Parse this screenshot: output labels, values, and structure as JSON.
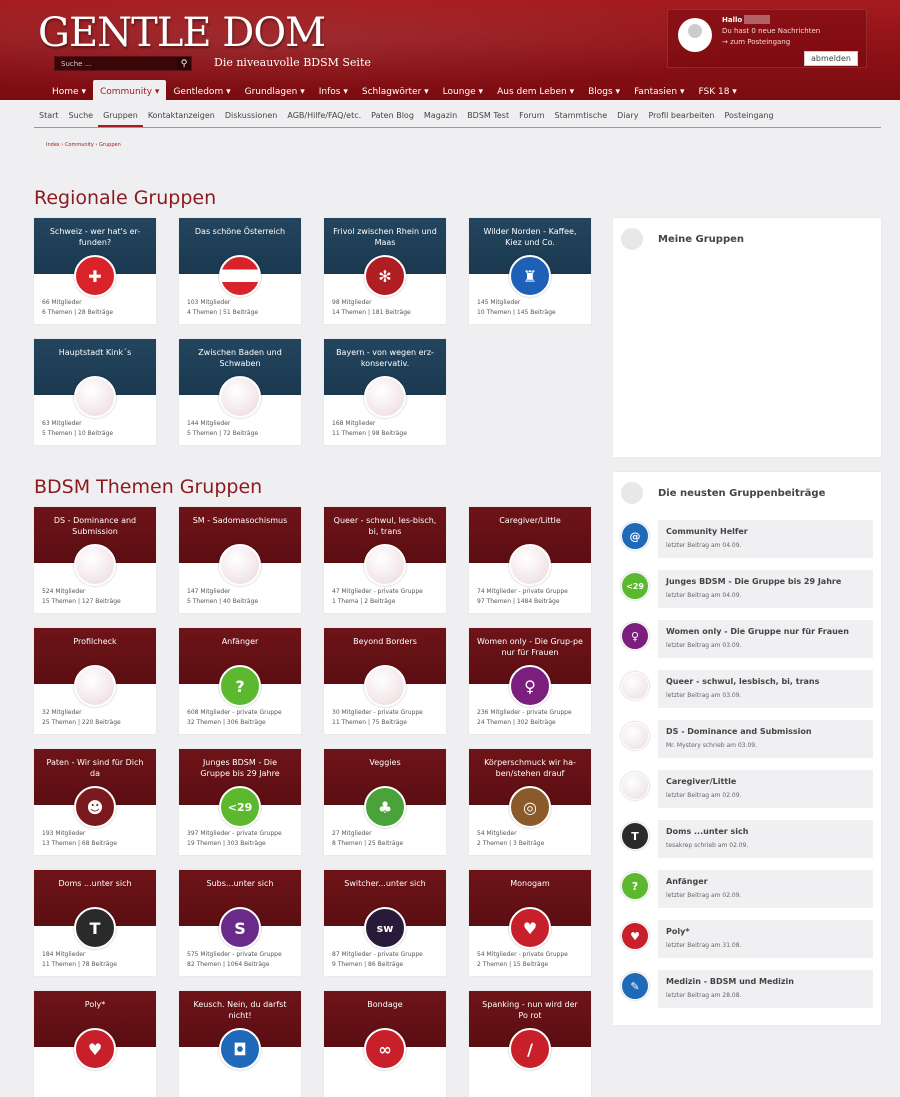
{
  "header": {
    "logo": "GENTLE DOM",
    "tagline": "Die niveauvolle BDSM Seite",
    "search_placeholder": "Suche ...",
    "user": {
      "hello": "Hallo",
      "messages": "Du hast 0 neue Nachrichten",
      "inbox": "→ zum Posteingang",
      "logout": "abmelden"
    }
  },
  "nav": [
    "Home ▾",
    "Community ▾",
    "Gentledom ▾",
    "Grundlagen ▾",
    "Infos ▾",
    "Schlagwörter ▾",
    "Lounge ▾",
    "Aus dem Leben ▾",
    "Blogs ▾",
    "Fantasien ▾",
    "FSK 18 ▾"
  ],
  "subnav": [
    "Start",
    "Suche",
    "Gruppen",
    "Kontaktanzeigen",
    "Diskussionen",
    "AGB/Hilfe/FAQ/etc.",
    "Paten Blog",
    "Magazin",
    "BDSM Test",
    "Forum",
    "Stammtische",
    "Diary",
    "Profil bearbeiten",
    "Posteingang"
  ],
  "breadcrumb": "Index › Community › Gruppen",
  "regional": {
    "title": "Regionale Gruppen",
    "cards": [
      {
        "name": "Schweiz - wer hat's er-funden?",
        "members": "66 Mitglieder",
        "topics": "6 Themen | 28 Beiträge",
        "icon": "swiss-cross-icon",
        "color": "#d8232a",
        "glyph": "✚"
      },
      {
        "name": "Das schöne Österreich",
        "members": "103 Mitglieder",
        "topics": "4 Themen | 51 Beiträge",
        "icon": "austria-flag-icon",
        "color": "#d8232a",
        "glyph": ""
      },
      {
        "name": "Frivol zwischen Rhein und Maas",
        "members": "98 Mitglieder",
        "topics": "14 Themen | 181 Beiträge",
        "icon": "windmill-icon",
        "color": "#b01e24",
        "glyph": "✻"
      },
      {
        "name": "Wilder Norden - Kaffee, Kiez und Co.",
        "members": "145 Mitglieder",
        "topics": "10 Themen | 145 Beiträge",
        "icon": "lighthouse-icon",
        "color": "#1e5fb8",
        "glyph": "♜"
      },
      {
        "name": "Hauptstadt Kink´s",
        "members": "63 Mitglieder",
        "topics": "5 Themen | 10 Beiträge",
        "icon": "placeholder-icon",
        "color": "",
        "glyph": ""
      },
      {
        "name": "Zwischen Baden und Schwaben",
        "members": "144 Mitglieder",
        "topics": "5 Themen | 72 Beiträge",
        "icon": "placeholder-icon",
        "color": "",
        "glyph": ""
      },
      {
        "name": "Bayern - von wegen erz-konservativ.",
        "members": "168 Mitglieder",
        "topics": "11 Themen | 98 Beiträge",
        "icon": "placeholder-icon",
        "color": "",
        "glyph": ""
      }
    ]
  },
  "themen": {
    "title": "BDSM Themen Gruppen",
    "cards": [
      {
        "name": "DS - Dominance and Submission",
        "members": "524 Mitglieder",
        "topics": "15 Themen | 127 Beiträge",
        "icon": "placeholder-icon",
        "color": "",
        "glyph": ""
      },
      {
        "name": "SM - Sadomasochismus",
        "members": "147 Mitglieder",
        "topics": "5 Themen | 40 Beiträge",
        "icon": "placeholder-icon",
        "color": "",
        "glyph": ""
      },
      {
        "name": "Queer - schwul, les-bisch, bi, trans",
        "members": "47 Mitglieder - private Gruppe",
        "topics": "1 Thema | 2 Beiträge",
        "icon": "placeholder-icon",
        "color": "",
        "glyph": ""
      },
      {
        "name": "Caregiver/Little",
        "members": "74 Mitglieder - private Gruppe",
        "topics": "97 Themen | 1484 Beiträge",
        "icon": "placeholder-icon",
        "color": "",
        "glyph": ""
      },
      {
        "name": "Profilcheck",
        "members": "32 Mitglieder",
        "topics": "25 Themen | 220 Beiträge",
        "icon": "placeholder-icon",
        "color": "",
        "glyph": ""
      },
      {
        "name": "Anfänger",
        "members": "608 Mitglieder - private Gruppe",
        "topics": "32 Themen | 306 Beiträge",
        "icon": "question-icon",
        "color": "#5cb82e",
        "glyph": "?"
      },
      {
        "name": "Beyond Borders",
        "members": "30 Mitglieder - private Gruppe",
        "topics": "11 Themen | 75 Beiträge",
        "icon": "placeholder-icon",
        "color": "",
        "glyph": ""
      },
      {
        "name": "Women only - Die Grup-pe nur für Frauen",
        "members": "236 Mitglieder - private Gruppe",
        "topics": "24 Themen | 302 Beiträge",
        "icon": "female-symbol-icon",
        "color": "#7a1f7e",
        "glyph": "♀"
      },
      {
        "name": "Paten - Wir sind für Dich da",
        "members": "193 Mitglieder",
        "topics": "13 Themen | 68 Beiträge",
        "icon": "people-group-icon",
        "color": "#7a1a1e",
        "glyph": "☻"
      },
      {
        "name": "Junges BDSM - Die Gruppe bis 29 Jahre",
        "members": "397 Mitglieder - private Gruppe",
        "topics": "19 Themen | 303 Beiträge",
        "icon": "under-29-icon",
        "color": "#5cb82e",
        "glyph": "<29"
      },
      {
        "name": "Veggies",
        "members": "27 Mitglieder",
        "topics": "8 Themen | 25 Beiträge",
        "icon": "clover-plate-icon",
        "color": "#4aa23a",
        "glyph": "♣"
      },
      {
        "name": "Körperschmuck wir ha-ben/stehen drauf",
        "members": "54 Mitglieder",
        "topics": "2 Themen | 3 Beiträge",
        "icon": "piercing-ring-icon",
        "color": "#8a5a2a",
        "glyph": "◎"
      },
      {
        "name": "Doms ...unter sich",
        "members": "184 Mitglieder",
        "topics": "11 Themen | 78 Beiträge",
        "icon": "the-dominant-icon",
        "color": "#2a2a2a",
        "glyph": "T"
      },
      {
        "name": "Subs...unter sich",
        "members": "575 Mitglieder - private Gruppe",
        "topics": "82 Themen | 1064 Beiträge",
        "icon": "submissive-icon",
        "color": "#6a2a8a",
        "glyph": "S"
      },
      {
        "name": "Switcher...unter sich",
        "members": "87 Mitglieder - private Gruppe",
        "topics": "9 Themen | 86 Beiträge",
        "icon": "switch-icon",
        "color": "#2a1a3a",
        "glyph": "sw"
      },
      {
        "name": "Monogam",
        "members": "54 Mitglieder - private Gruppe",
        "topics": "2 Themen | 15 Beiträge",
        "icon": "heart-icon",
        "color": "#c8202a",
        "glyph": "♥"
      },
      {
        "name": "Poly*",
        "members": "",
        "topics": "",
        "icon": "hearts-icon",
        "color": "#c8202a",
        "glyph": "♥"
      },
      {
        "name": "Keusch. Nein, du darfst nicht!",
        "members": "",
        "topics": "",
        "icon": "lock-icon",
        "color": "#1e6ab8",
        "glyph": "◘"
      },
      {
        "name": "Bondage",
        "members": "",
        "topics": "",
        "icon": "rope-icon",
        "color": "#c8202a",
        "glyph": "∞"
      },
      {
        "name": "Spanking - nun wird der Po rot",
        "members": "",
        "topics": "",
        "icon": "paddle-icon",
        "color": "#c8202a",
        "glyph": "/"
      }
    ]
  },
  "sidebar": {
    "my_groups": {
      "title": "Meine Gruppen"
    },
    "latest": {
      "title": "Die neusten Gruppenbeiträge",
      "posts": [
        {
          "title": "Community Helfer",
          "sub": "letzter Beitrag am 04.09.",
          "icon": "at-sign-icon",
          "color": "#1e6ab8",
          "glyph": "@"
        },
        {
          "title": "Junges BDSM - Die Gruppe bis 29 Jahre",
          "sub": "letzter Beitrag am 04.09.",
          "icon": "under-29-icon",
          "color": "#5cb82e",
          "glyph": "<29"
        },
        {
          "title": "Women only - Die Gruppe nur für Frauen",
          "sub": "letzter Beitrag am 03.09.",
          "icon": "female-symbol-icon",
          "color": "#7a1f7e",
          "glyph": "♀"
        },
        {
          "title": "Queer - schwul, lesbisch, bi, trans",
          "sub": "letzter Beitrag am 03.09.",
          "icon": "placeholder-icon",
          "color": "",
          "glyph": ""
        },
        {
          "title": "DS - Dominance and Submission",
          "sub": "Mr. Mystery schrieb am 03.09.",
          "icon": "placeholder-icon",
          "color": "",
          "glyph": ""
        },
        {
          "title": "Caregiver/Little",
          "sub": "letzter Beitrag am 02.09.",
          "icon": "placeholder-icon",
          "color": "",
          "glyph": ""
        },
        {
          "title": "Doms ...unter sich",
          "sub": "tesakrep schrieb am 02.09.",
          "icon": "the-dominant-icon",
          "color": "#2a2a2a",
          "glyph": "T"
        },
        {
          "title": "Anfänger",
          "sub": "letzter Beitrag am 02.09.",
          "icon": "question-icon",
          "color": "#5cb82e",
          "glyph": "?"
        },
        {
          "title": "Poly*",
          "sub": "letzter Beitrag am 31.08.",
          "icon": "hearts-icon",
          "color": "#c8202a",
          "glyph": "♥"
        },
        {
          "title": "Medizin - BDSM und Medizin",
          "sub": "letzter Beitrag am 28.08.",
          "icon": "syringe-icon",
          "color": "#1e6ab8",
          "glyph": "✎"
        }
      ]
    }
  }
}
